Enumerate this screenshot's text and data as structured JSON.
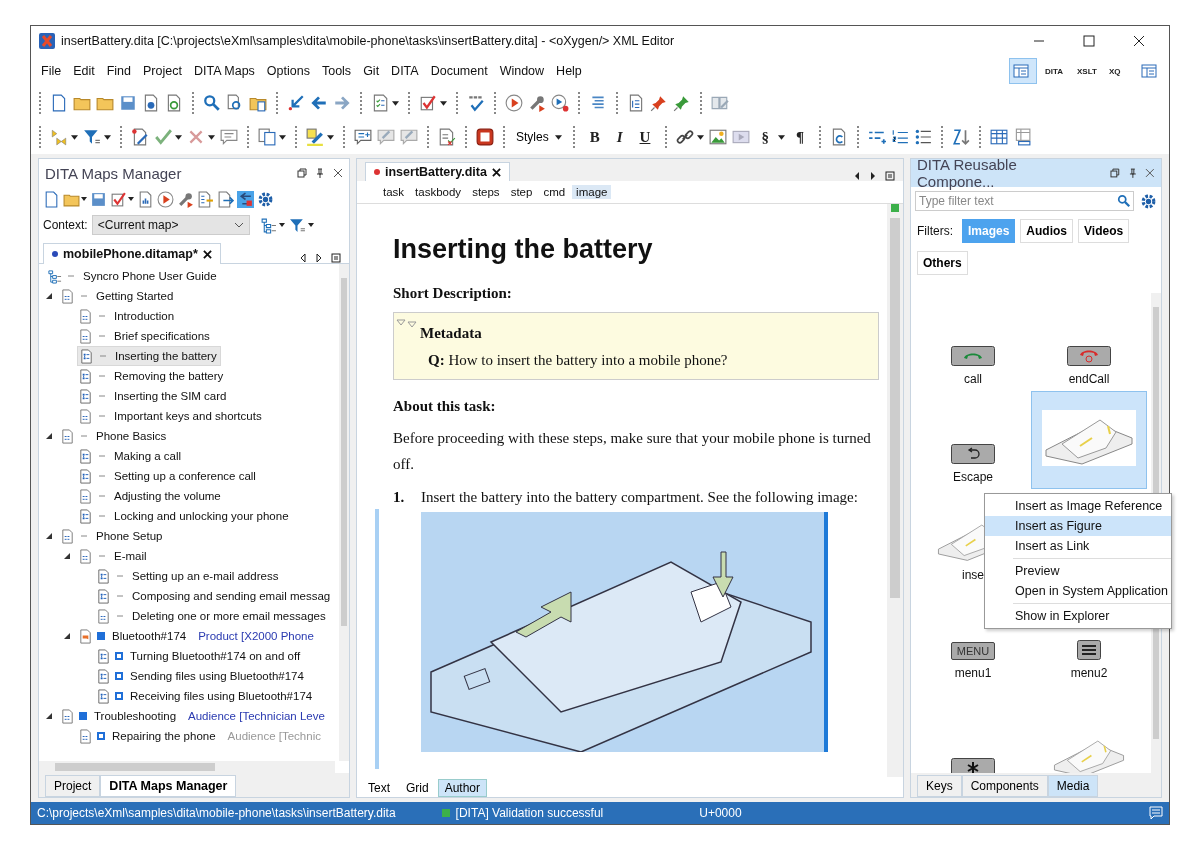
{
  "window": {
    "title": "insertBattery.dita [C:\\projects\\eXml\\samples\\dita\\mobile-phone\\tasks\\insertBattery.dita] - <oXygen/> XML Editor"
  },
  "menu": [
    "File",
    "Edit",
    "Find",
    "Project",
    "DITA Maps",
    "Options",
    "Tools",
    "Git",
    "DITA",
    "Document",
    "Window",
    "Help"
  ],
  "perspectives": [
    {
      "selected": true
    },
    {
      "label": "DITA",
      "selected": false
    },
    {
      "label": "XSLT",
      "selected": false
    },
    {
      "label": "XQ",
      "selected": false
    },
    {
      "selected": false
    }
  ],
  "format_toolbar": {
    "styles": "Styles",
    "bold": "B",
    "italic": "I",
    "underline": "U",
    "section": "§",
    "pilcrow": "¶"
  },
  "maps_manager": {
    "title": "DITA Maps Manager",
    "context_label": "Context:",
    "context_value": "<Current map>",
    "tab": {
      "label": "mobilePhone.ditamap*",
      "modified": true
    },
    "root": {
      "title": "Syncro Phone User Guide",
      "selected": false
    },
    "tree": [
      {
        "title": "Getting Started",
        "kind": "concept",
        "profiled": false,
        "expanded": true,
        "selected": false,
        "children": [
          {
            "title": "Introduction",
            "kind": "concept",
            "profiled": false,
            "selected": false
          },
          {
            "title": "Brief specifications",
            "kind": "concept",
            "profiled": false,
            "selected": false
          },
          {
            "title": "Inserting the battery",
            "kind": "task",
            "profiled": false,
            "selected": true
          },
          {
            "title": "Removing the battery",
            "kind": "task",
            "profiled": false,
            "selected": false
          },
          {
            "title": "Inserting the SIM card",
            "kind": "task",
            "profiled": false,
            "selected": false
          },
          {
            "title": "Important keys and shortcuts",
            "kind": "concept",
            "profiled": false,
            "selected": false
          }
        ]
      },
      {
        "title": "Phone Basics",
        "kind": "concept",
        "profiled": false,
        "expanded": true,
        "selected": false,
        "children": [
          {
            "title": "Making a call",
            "kind": "task",
            "profiled": false,
            "selected": false
          },
          {
            "title": "Setting up a conference call",
            "kind": "task",
            "profiled": false,
            "selected": false
          },
          {
            "title": "Adjusting the volume",
            "kind": "concept",
            "profiled": false,
            "selected": false
          },
          {
            "title": "Locking and unlocking your phone",
            "kind": "task",
            "profiled": false,
            "selected": false
          }
        ]
      },
      {
        "title": "Phone Setup",
        "kind": "concept",
        "profiled": false,
        "expanded": true,
        "selected": false,
        "children": [
          {
            "title": "E-mail",
            "kind": "concept",
            "profiled": false,
            "expanded": true,
            "selected": false,
            "children": [
              {
                "title": "Setting up an e-mail address",
                "kind": "task",
                "profiled": false,
                "selected": false
              },
              {
                "title": "Composing and sending email messag",
                "kind": "task",
                "profiled": false,
                "selected": false
              },
              {
                "title": "Deleting one or more email messages",
                "kind": "concept",
                "profiled": false,
                "selected": false
              }
            ]
          },
          {
            "title": "Bluetooth#174",
            "kind": "keydef",
            "profiled": true,
            "inherited": false,
            "attribute": "Product [X2000 Phone",
            "expanded": true,
            "selected": false,
            "children": [
              {
                "title": "Turning Bluetooth#174 on and off",
                "kind": "task",
                "profiled": true,
                "inherited": true,
                "selected": false
              },
              {
                "title": "Sending files using Bluetooth#174",
                "kind": "task",
                "profiled": true,
                "inherited": true,
                "selected": false
              },
              {
                "title": "Receiving files using Bluetooth#174",
                "kind": "task",
                "profiled": true,
                "inherited": true,
                "selected": false
              }
            ]
          }
        ]
      },
      {
        "title": "Troubleshooting",
        "kind": "concept",
        "profiled": true,
        "inherited": false,
        "attribute": "Audience [Technician Leve",
        "expanded": true,
        "selected": false,
        "children": [
          {
            "title": "Repairing the phone",
            "kind": "concept",
            "profiled": true,
            "inherited": true,
            "attribute": "Audience [Technic",
            "selected": false
          }
        ]
      }
    ],
    "bottom_tabs": [
      {
        "label": "Project",
        "selected": false
      },
      {
        "label": "DITA Maps Manager",
        "selected": true
      }
    ]
  },
  "editor": {
    "tab": {
      "label": "insertBattery.dita",
      "modified": true
    },
    "breadcrumb": [
      {
        "label": "task",
        "selected": false
      },
      {
        "label": "taskbody",
        "selected": false
      },
      {
        "label": "steps",
        "selected": false
      },
      {
        "label": "step",
        "selected": false
      },
      {
        "label": "cmd",
        "selected": false
      },
      {
        "label": "image",
        "selected": true
      }
    ],
    "heading": "Inserting the battery",
    "short_description": "Short Description:",
    "metadata_title": "Metadata",
    "metadata_text": "**Q:** How to insert the battery into a mobile phone?",
    "about_label": "About this task:",
    "about_text": "Before proceeding with these steps, make sure that your mobile phone is turned off.",
    "step_number": "1.",
    "step_text": "Insert the battery into the battery compartment. See the following image:",
    "modes": [
      {
        "label": "Text",
        "selected": false
      },
      {
        "label": "Grid",
        "selected": false
      },
      {
        "label": "Author",
        "selected": true
      }
    ]
  },
  "components": {
    "title": "DITA Reusable Compone...",
    "filter_placeholder": "Type filter text",
    "filters_label": "Filters:",
    "filters": [
      {
        "label": "Images",
        "selected": true
      },
      {
        "label": "Audios",
        "selected": false
      },
      {
        "label": "Videos",
        "selected": false
      },
      {
        "label": "Others",
        "selected": false
      }
    ],
    "media_rows": [
      [
        {
          "kind": "call",
          "label": "call",
          "selected": false
        },
        {
          "kind": "endcall",
          "label": "endCall",
          "selected": false
        }
      ],
      [
        {
          "kind": "escape",
          "label": "Escape",
          "selected": false
        },
        {
          "kind": "phone",
          "selected": true
        }
      ],
      [
        {
          "kind": "phone",
          "label": "inse",
          "selected": false
        }
      ],
      [
        {
          "kind": "key",
          "button_text": "MENU",
          "label": "menu1",
          "selected": false
        },
        {
          "kind": "lines",
          "label": "menu2",
          "selected": false
        }
      ],
      [
        {
          "kind": "star",
          "selected": false
        },
        {
          "kind": "phone",
          "selected": false
        }
      ]
    ],
    "bottom_tabs": [
      {
        "label": "Keys",
        "selected": false
      },
      {
        "label": "Components",
        "selected": false
      },
      {
        "label": "Media",
        "selected": true
      }
    ]
  },
  "context_menu": [
    {
      "label": "Insert as Image Reference",
      "selected": false
    },
    {
      "label": "Insert as Figure",
      "selected": true
    },
    {
      "label": "Insert as Link",
      "selected": false,
      "separator_after": true
    },
    {
      "label": "Preview",
      "selected": false
    },
    {
      "label": "Open in System Application",
      "selected": false,
      "separator_after": true
    },
    {
      "label": "Show in Explorer",
      "selected": false
    }
  ],
  "status_bar": {
    "path": "C:\\projects\\eXml\\samples\\dita\\mobile-phone\\tasks\\insertBattery.dita",
    "validation": "[DITA] Validation successful",
    "validation_ok": true,
    "encoding": "U+0000"
  }
}
